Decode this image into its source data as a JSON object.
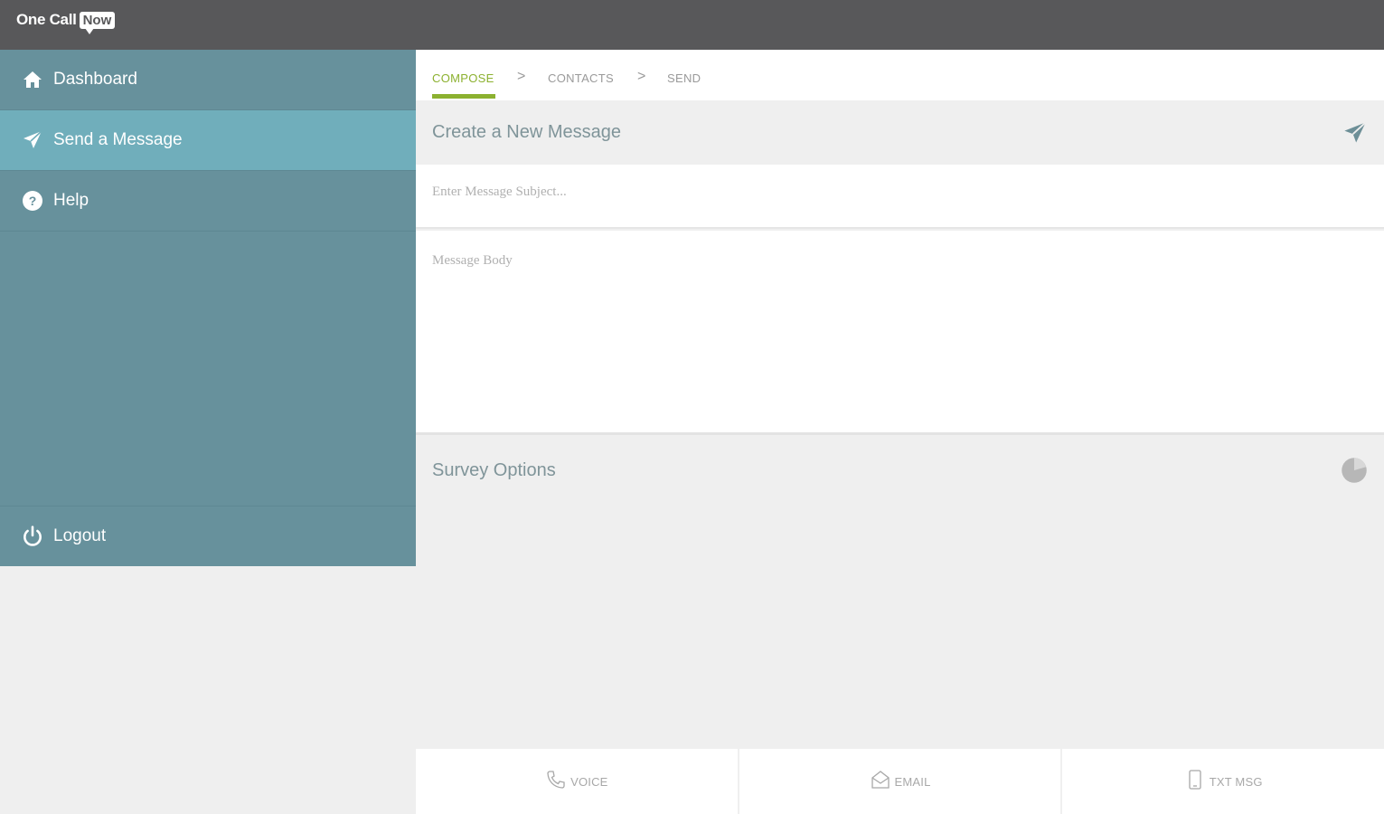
{
  "header": {
    "logo_one_call": "One Call",
    "logo_now": "Now"
  },
  "sidebar": {
    "items": [
      {
        "label": "Dashboard",
        "icon": "home-icon"
      },
      {
        "label": "Send a Message",
        "icon": "send-icon",
        "active": true
      },
      {
        "label": "Help",
        "icon": "help-icon"
      }
    ],
    "logout": {
      "label": "Logout",
      "icon": "power-icon"
    }
  },
  "steps": {
    "compose": "COMPOSE",
    "sep": ">",
    "contacts": "CONTACTS",
    "send": "SEND"
  },
  "compose": {
    "title": "Create a New Message",
    "subject_placeholder": "Enter Message Subject...",
    "body_placeholder": "Message Body"
  },
  "survey": {
    "title": "Survey Options"
  },
  "channels": [
    {
      "label": "VOICE",
      "icon": "phone-icon"
    },
    {
      "label": "EMAIL",
      "icon": "envelope-icon"
    },
    {
      "label": "TXT MSG",
      "icon": "mobile-icon"
    }
  ],
  "colors": {
    "topbar": "#58585a",
    "sidebar": "#67919c",
    "sidebar_active": "#70aebb",
    "accent": "#8cb130"
  }
}
